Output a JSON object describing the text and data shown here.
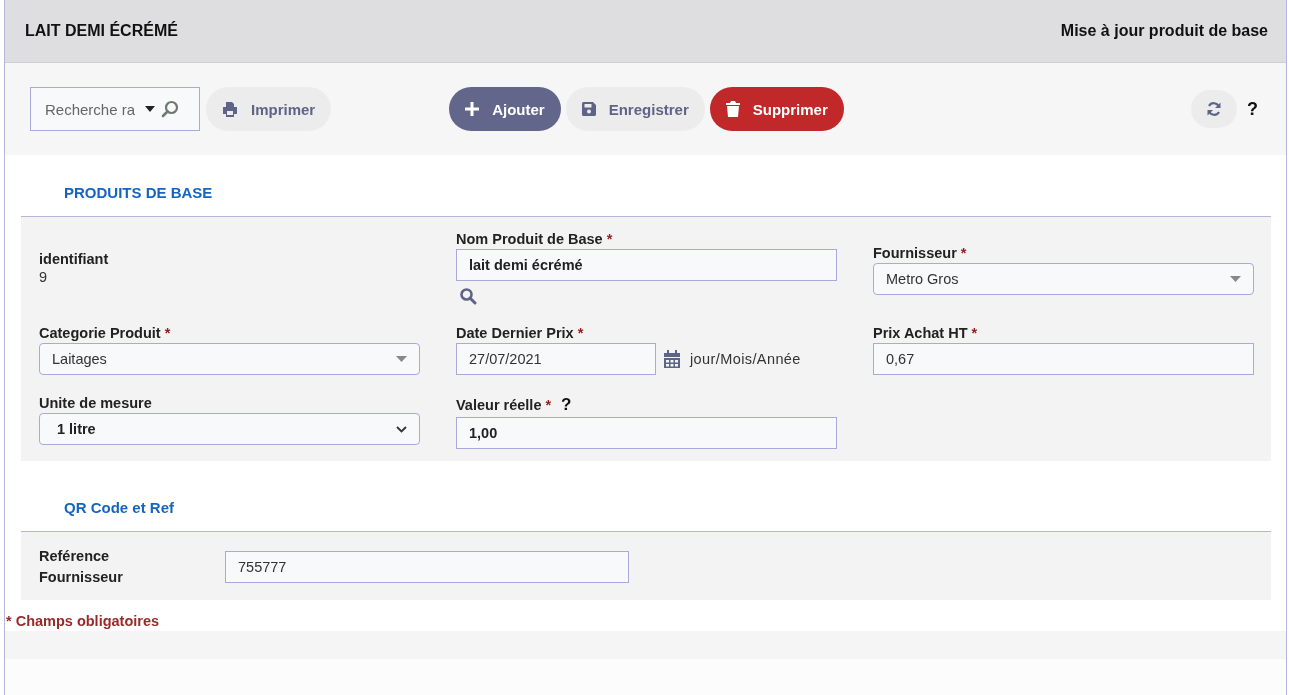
{
  "header": {
    "title": "LAIT DEMI ÉCRÉMÉ",
    "subtitle": "Mise à jour produit de base"
  },
  "toolbar": {
    "search": {
      "placeholder": "Recherche ra"
    },
    "left_buttons": [
      {
        "label": "Imprimer",
        "kind": "print"
      }
    ],
    "center_buttons": [
      {
        "label": "Ajouter",
        "kind": "add"
      },
      {
        "label": "Enregistrer",
        "kind": "save"
      },
      {
        "label": "Supprimer",
        "kind": "delete"
      }
    ],
    "help": "?"
  },
  "required_mark": "*",
  "sections": [
    {
      "title": "PRODUITS DE BASE",
      "fields": [
        {
          "kind": "display",
          "label": "identifiant",
          "value": "9",
          "required": false
        },
        {
          "kind": "lookup",
          "label": "Nom Produit de Base",
          "value": "lait demi écrémé",
          "required": true,
          "bold": true
        },
        {
          "kind": "dropdown",
          "label": "Fournisseur",
          "value": "Metro Gros",
          "required": true
        },
        {
          "kind": "dropdown",
          "label": "Categorie Produit",
          "value": "Laitages",
          "required": true
        },
        {
          "kind": "date",
          "label": "Date Dernier Prix",
          "value": "27/07/2021",
          "required": true,
          "hint": "jour/Mois/Année"
        },
        {
          "kind": "text",
          "label": "Prix Achat HT",
          "value": "0,67",
          "required": true,
          "bold": false
        },
        {
          "kind": "select",
          "label": "Unite de mesure",
          "value": "1 litre",
          "required": false
        },
        {
          "kind": "text",
          "label": "Valeur réelle",
          "value": "1,00",
          "required": true,
          "bold": true,
          "help": "?"
        }
      ]
    },
    {
      "title": "QR Code et Ref",
      "fields": [
        {
          "kind": "inline",
          "label": "Reférence Fournisseur",
          "value": "755777",
          "required": false
        }
      ]
    }
  ],
  "footer_note": "* Champs obligatoires"
}
